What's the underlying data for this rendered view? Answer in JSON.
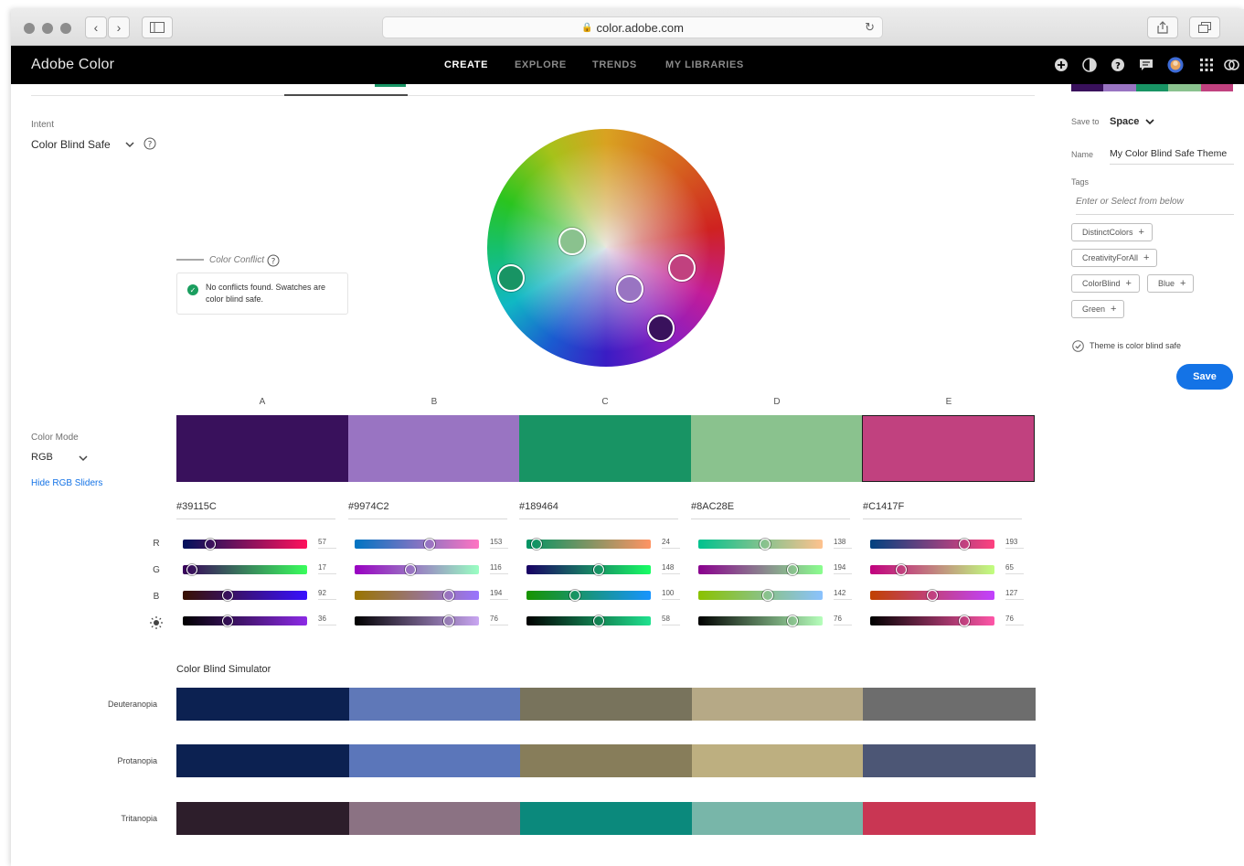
{
  "browser": {
    "url": "color.adobe.com"
  },
  "app": {
    "brand": "Adobe Color",
    "nav": [
      {
        "label": "CREATE",
        "active": true
      },
      {
        "label": "EXPLORE",
        "active": false
      },
      {
        "label": "TRENDS",
        "active": false
      },
      {
        "label": "MY LIBRARIES",
        "active": false
      }
    ]
  },
  "left": {
    "intent_label": "Intent",
    "intent_value": "Color Blind Safe",
    "color_mode_label": "Color Mode",
    "color_mode_value": "RGB",
    "hide_sliders_link": "Hide RGB Sliders"
  },
  "conflict": {
    "legend_label": "Color Conflict",
    "message": "No conflicts found. Swatches are color blind safe."
  },
  "swatches": [
    {
      "letter": "A",
      "hex": "#39115C",
      "color": "#39115c",
      "r": 57,
      "g": 17,
      "b": 92,
      "brightness": 36
    },
    {
      "letter": "B",
      "hex": "#9974C2",
      "color": "#9974c2",
      "r": 153,
      "g": 116,
      "b": 194,
      "brightness": 76
    },
    {
      "letter": "C",
      "hex": "#189464",
      "color": "#189464",
      "r": 24,
      "g": 148,
      "b": 100,
      "brightness": 58
    },
    {
      "letter": "D",
      "hex": "#8AC28E",
      "color": "#8ac28e",
      "r": 138,
      "g": 194,
      "b": 142,
      "brightness": 76
    },
    {
      "letter": "E",
      "hex": "#C1417F",
      "color": "#c1417f",
      "r": 193,
      "g": 65,
      "b": 127,
      "brightness": 76
    }
  ],
  "slider_rows": [
    "R",
    "G",
    "B"
  ],
  "simulator": {
    "title": "Color Blind Simulator",
    "rows": [
      {
        "label": "Deuteranopia",
        "colors": [
          "#0c2151",
          "#5f78b8",
          "#78735c",
          "#b6a986",
          "#6d6d6d"
        ]
      },
      {
        "label": "Protanopia",
        "colors": [
          "#0c2151",
          "#5b76ba",
          "#877d5a",
          "#bdaf80",
          "#4c5675"
        ]
      },
      {
        "label": "Tritanopia",
        "colors": [
          "#2d1e2b",
          "#8b7283",
          "#0b897c",
          "#78b6a9",
          "#c93653"
        ]
      }
    ]
  },
  "panel": {
    "save_to_label": "Save to",
    "save_to_value": "Space",
    "name_label": "Name",
    "name_value": "My Color Blind Safe Theme",
    "tags_label": "Tags",
    "tags_placeholder": "Enter or Select from below",
    "tags": [
      "DistinctColors",
      "CreativityForAll",
      "ColorBlind",
      "Blue",
      "Green"
    ],
    "safe_check_label": "Theme is color blind safe",
    "save_button": "Save"
  },
  "colors": {
    "accent": "#1473e6",
    "appbar": "#000000"
  }
}
